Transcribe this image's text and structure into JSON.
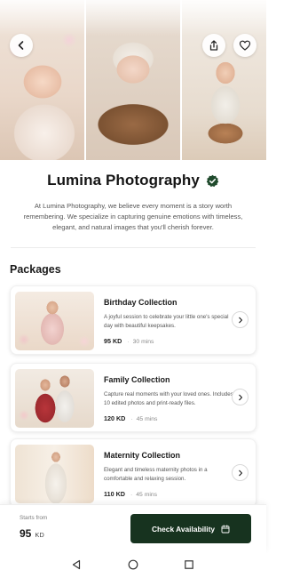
{
  "studio": {
    "name": "Lumina Photography",
    "about": "At Lumina Photography, we believe every moment is a story worth remembering. We specialize in capturing genuine emotions with timeless, elegant, and natural images that you'll cherish forever."
  },
  "packages_section": {
    "title": "Packages"
  },
  "packages": [
    {
      "title": "Birthday Collection",
      "description": "A joyful session to celebrate your little one's special day with beautiful keepsakes.",
      "price": "95 KD",
      "duration": "30 mins"
    },
    {
      "title": "Family Collection",
      "description": "Capture real moments with your loved ones. Includes 10 edited photos and print-ready files.",
      "price": "120 KD",
      "duration": "45 mins"
    },
    {
      "title": "Maternity Collection",
      "description": "Elegant and timeless maternity photos in a comfortable and relaxing session.",
      "price": "110 KD",
      "duration": "45 mins"
    }
  ],
  "booking": {
    "from_label": "Starts from",
    "from_amount": "95",
    "currency": "KD",
    "cta_label": "Check Availability"
  },
  "icons": {
    "back": "chevron-left-icon",
    "share": "share-icon",
    "favorite": "heart-icon",
    "verified": "verified-badge-icon",
    "card_action": "chevron-right-icon",
    "calendar": "calendar-icon",
    "nav_back": "triangle-back-icon",
    "nav_home": "circle-home-icon",
    "nav_recents": "square-recents-icon"
  },
  "colors": {
    "cta_background": "#17331f",
    "verified_badge": "#1f4a2c",
    "text_primary": "#1c1c1c",
    "text_secondary": "#555555"
  }
}
